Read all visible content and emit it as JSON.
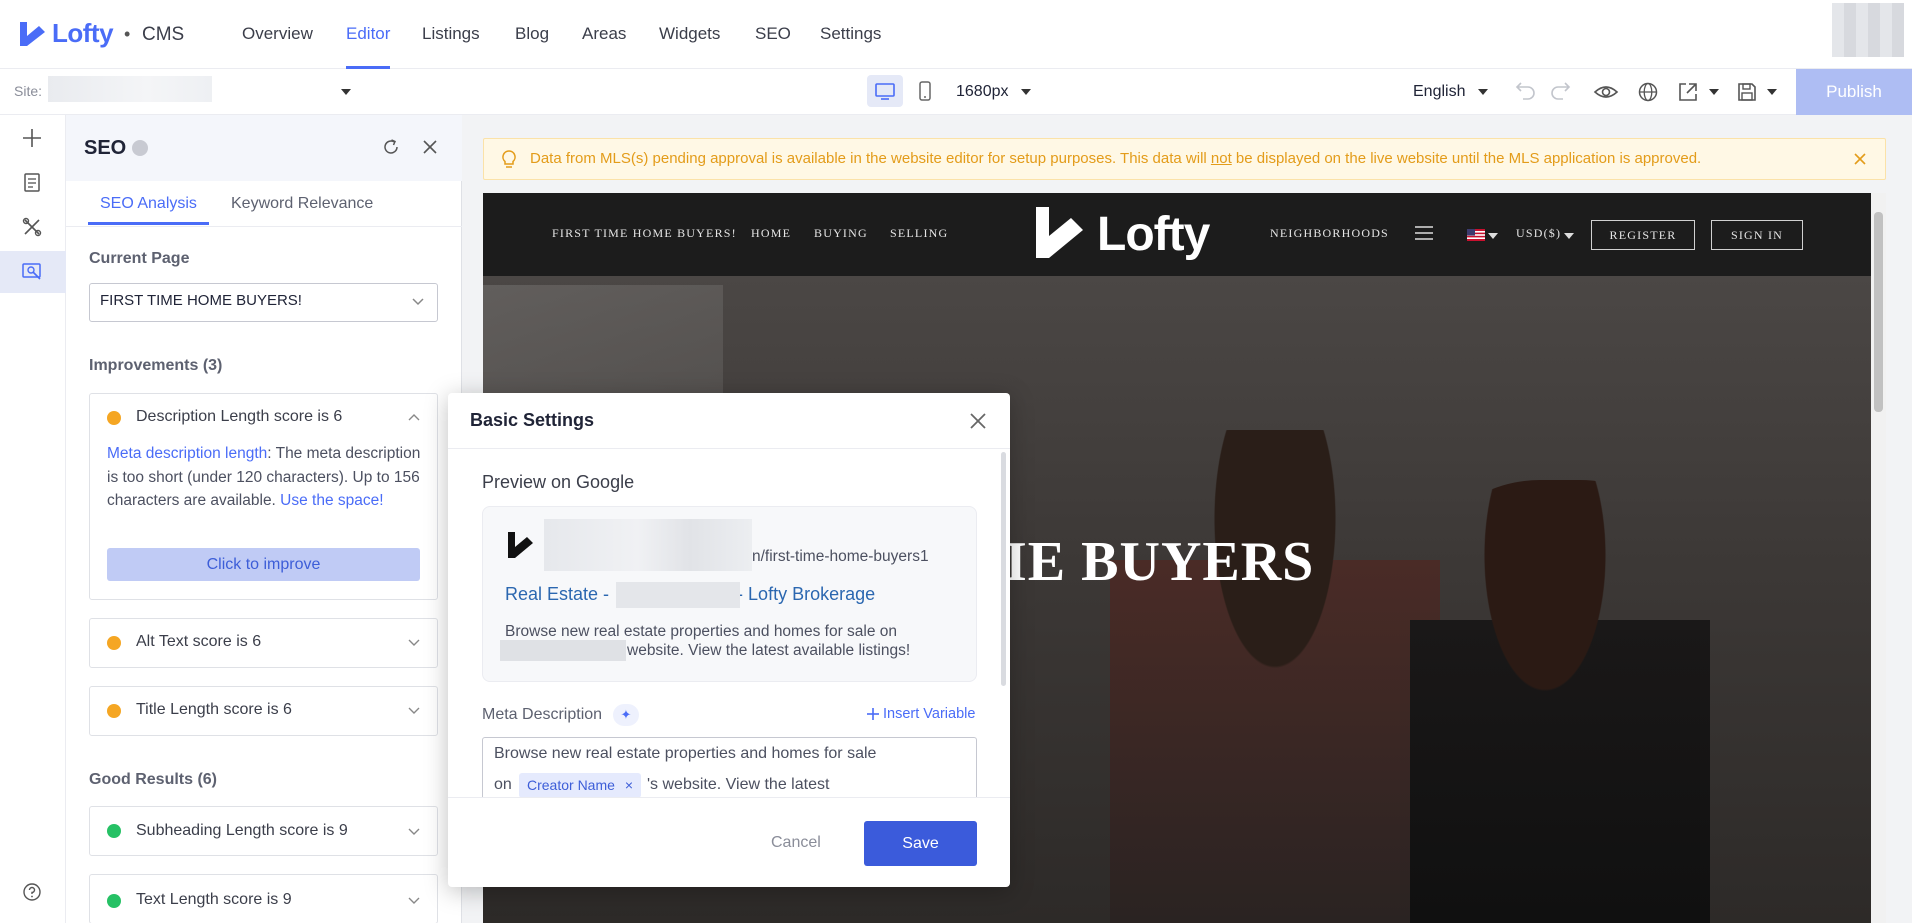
{
  "app": {
    "logo_text": "Lofty",
    "separator": "•",
    "product": "CMS",
    "nav": [
      {
        "label": "Overview"
      },
      {
        "label": "Editor"
      },
      {
        "label": "Listings"
      },
      {
        "label": "Blog"
      },
      {
        "label": "Areas"
      },
      {
        "label": "Widgets"
      },
      {
        "label": "SEO"
      },
      {
        "label": "Settings"
      }
    ],
    "active_nav": "Editor"
  },
  "toolbar": {
    "site_label": "Site:",
    "viewport": "1680px",
    "language": "English",
    "publish_label": "Publish"
  },
  "seo_panel": {
    "title": "SEO",
    "tabs": [
      {
        "label": "SEO Analysis"
      },
      {
        "label": "Keyword Relevance"
      }
    ],
    "current_page_label": "Current Page",
    "current_page_value": "FIRST TIME HOME BUYERS!",
    "improvements_title": "Improvements (3)",
    "improvements": [
      {
        "title": "Description Length score is 6",
        "link_text": "Meta description length",
        "body": ": The meta description is too short (under 120 characters). Up to 156 characters are available. ",
        "cta_link": "Use the space!",
        "button": "Click to improve"
      },
      {
        "title": "Alt Text score is 6"
      },
      {
        "title": "Title Length score is 6"
      }
    ],
    "good_title": "Good Results (6)",
    "good": [
      {
        "title": "Subheading Length score is 9"
      },
      {
        "title": "Text Length score is 9"
      }
    ],
    "colors": {
      "warning": "#f5a623",
      "good": "#26c165",
      "accent": "#4a6cf7"
    }
  },
  "preview": {
    "banner_pre": "Data from MLS(s) pending approval is available in the website editor for setup purposes. This data will ",
    "banner_emph": "not",
    "banner_post": " be displayed on the live website until the MLS application is approved.",
    "site_nav_left": [
      {
        "label": "FIRST TIME HOME BUYERS!"
      },
      {
        "label": "HOME"
      },
      {
        "label": "BUYING"
      },
      {
        "label": "SELLING"
      }
    ],
    "site_logo": "Lofty",
    "site_nav_right": "NEIGHBORHOODS",
    "currency": "USD($)",
    "register": "REGISTER",
    "sign_in": "SIGN IN",
    "hero_title_fragment": "IE BUYERS"
  },
  "modal": {
    "title": "Basic Settings",
    "preview_title": "Preview on Google",
    "url_suffix": "n/first-time-home-buyers1",
    "google_title_pre": "Real Estate -",
    "google_title_post": "- Lofty Brokerage",
    "google_desc_line1": "Browse new real estate properties and homes for sale on",
    "google_desc_line2": "website. View the latest available listings!",
    "meta_label": "Meta Description",
    "insert_variable": "Insert Variable",
    "meta_line1": "Browse new real estate properties and homes for sale",
    "meta_on": "on",
    "chip": "Creator Name",
    "meta_after_chip": "'s website. View the latest",
    "cancel": "Cancel",
    "save": "Save"
  }
}
